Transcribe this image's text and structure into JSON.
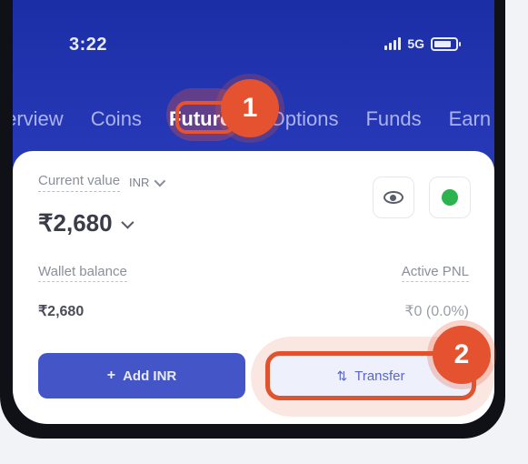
{
  "status_bar": {
    "time": "3:22",
    "network": "5G"
  },
  "tabs": [
    {
      "label": "Overview"
    },
    {
      "label": "Coins"
    },
    {
      "label": "Futures"
    },
    {
      "label": "Options"
    },
    {
      "label": "Funds"
    },
    {
      "label": "Earn"
    }
  ],
  "active_tab": "Futures",
  "badges": {
    "step1": "1",
    "step2": "2"
  },
  "card": {
    "current_value_label": "Current value",
    "currency": "INR",
    "current_value": "₹2,680",
    "wallet_balance_label": "Wallet balance",
    "wallet_balance": "₹2,680",
    "active_pnl_label": "Active PNL",
    "active_pnl": "₹0 (0.0%)",
    "add_button": "Add INR",
    "transfer_button": "Transfer"
  },
  "colors": {
    "header_blue": "#2638b6",
    "highlight_orange": "#e4522f",
    "add_button": "#4455c8"
  },
  "icons": {
    "visibility": "eye-icon",
    "whatsapp": "whatsapp-icon",
    "transfer": "transfer-icon",
    "add": "plus-icon"
  }
}
